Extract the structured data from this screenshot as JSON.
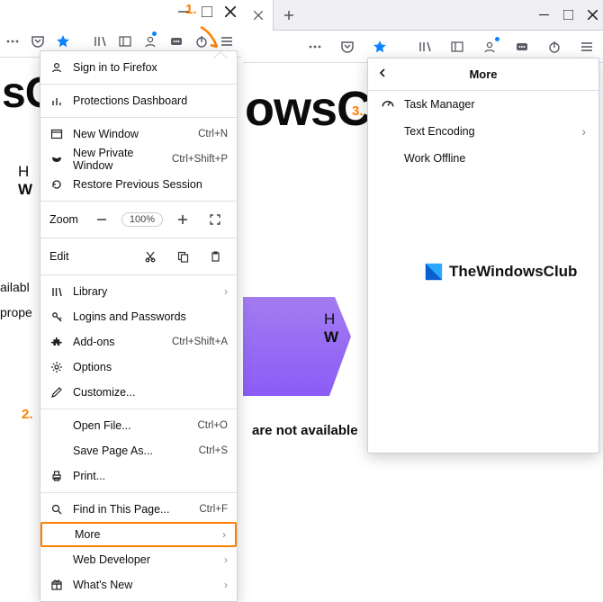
{
  "step_labels": {
    "one": "1.",
    "two": "2.",
    "three": "3."
  },
  "left": {
    "menu": {
      "signin": "Sign in to Firefox",
      "protections": "Protections Dashboard",
      "new_window": "New Window",
      "new_window_sc": "Ctrl+N",
      "new_private": "New Private Window",
      "new_private_sc": "Ctrl+Shift+P",
      "restore": "Restore Previous Session",
      "zoom_label": "Zoom",
      "zoom_value": "100%",
      "edit_label": "Edit",
      "library": "Library",
      "logins": "Logins and Passwords",
      "addons": "Add-ons",
      "addons_sc": "Ctrl+Shift+A",
      "options": "Options",
      "customize": "Customize...",
      "open_file": "Open File...",
      "open_file_sc": "Ctrl+O",
      "save_as": "Save Page As...",
      "save_as_sc": "Ctrl+S",
      "print": "Print...",
      "find": "Find in This Page...",
      "find_sc": "Ctrl+F",
      "more": "More",
      "web_dev": "Web Developer",
      "whats_new": "What's New"
    },
    "page": {
      "heading_part": "sC",
      "side1": "H",
      "side2": "W",
      "avail": "ailabl",
      "prop": "prope"
    }
  },
  "right": {
    "submenu": {
      "title": "More",
      "task_manager": "Task Manager",
      "text_encoding": "Text Encoding",
      "work_offline": "Work Offline"
    },
    "watermark": "TheWindowsClub",
    "page": {
      "heading_part": "owsC",
      "side1": "H",
      "side2": "W",
      "avail": "are not available"
    }
  }
}
